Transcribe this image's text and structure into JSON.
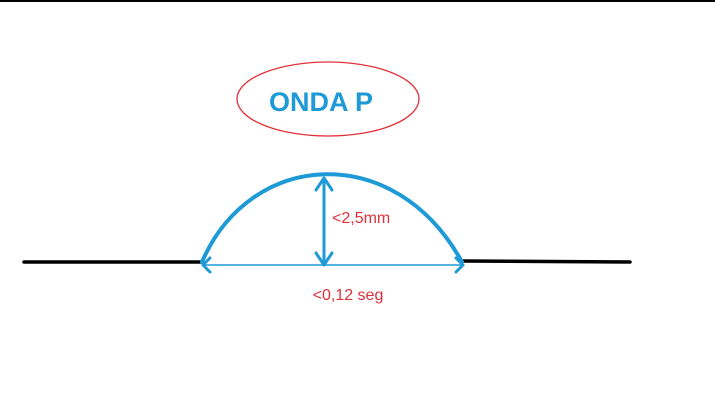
{
  "title": {
    "text": "ONDA P",
    "text_color": "#1e9ad6",
    "oval_color": "#e0313a"
  },
  "amplitude_label": "<2,5mm",
  "duration_label": "<0,12 seg",
  "colors": {
    "baseline": "#000000",
    "wave": "#1e9ad6",
    "arrows": "#1e9ad6",
    "labels": "#e0313a"
  }
}
